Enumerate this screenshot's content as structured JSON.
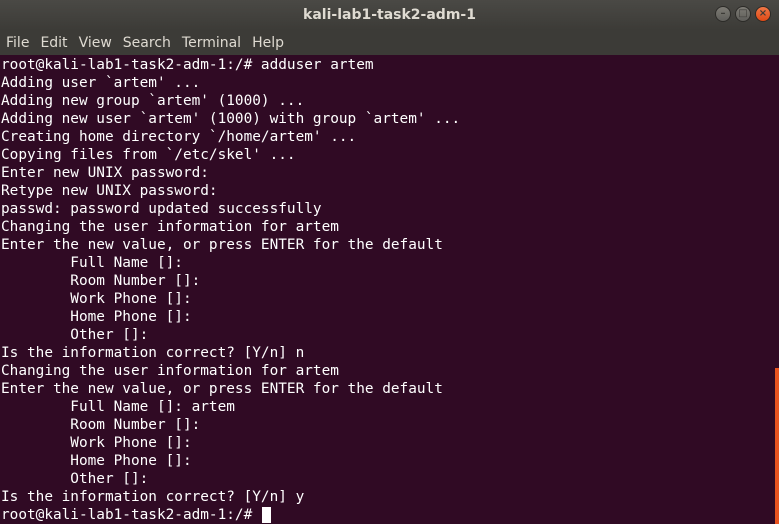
{
  "window": {
    "title": "kali-lab1-task2-adm-1"
  },
  "menu": [
    "File",
    "Edit",
    "View",
    "Search",
    "Terminal",
    "Help"
  ],
  "terminal": {
    "lines": [
      "root@kali-lab1-task2-adm-1:/# adduser artem",
      "Adding user `artem' ...",
      "Adding new group `artem' (1000) ...",
      "Adding new user `artem' (1000) with group `artem' ...",
      "Creating home directory `/home/artem' ...",
      "Copying files from `/etc/skel' ...",
      "Enter new UNIX password:",
      "Retype new UNIX password:",
      "passwd: password updated successfully",
      "Changing the user information for artem",
      "Enter the new value, or press ENTER for the default",
      "        Full Name []:",
      "        Room Number []:",
      "        Work Phone []:",
      "        Home Phone []:",
      "        Other []:",
      "Is the information correct? [Y/n] n",
      "Changing the user information for artem",
      "Enter the new value, or press ENTER for the default",
      "        Full Name []: artem",
      "        Room Number []:",
      "        Work Phone []:",
      "        Home Phone []:",
      "        Other []:",
      "Is the information correct? [Y/n] y"
    ],
    "prompt": "root@kali-lab1-task2-adm-1:/# "
  },
  "colors": {
    "background": "#300a24",
    "text": "#ffffff",
    "accent": "#e95420"
  }
}
